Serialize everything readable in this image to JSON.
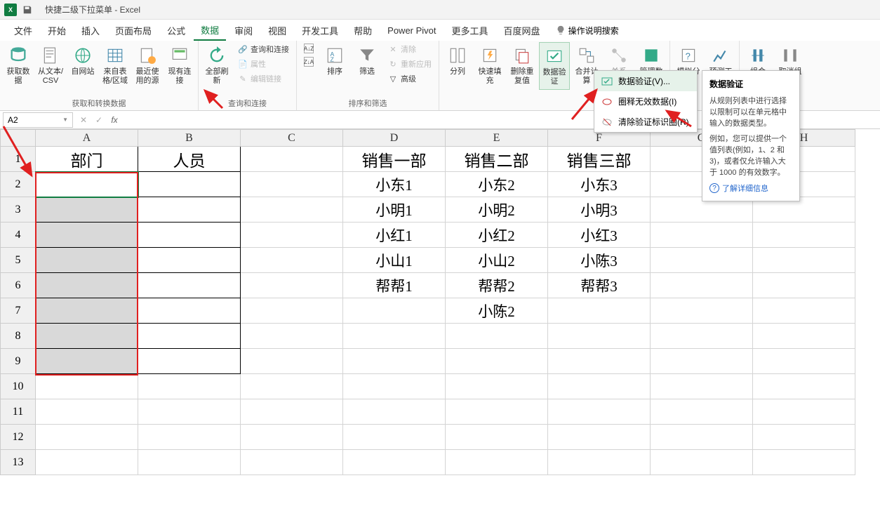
{
  "title": "快捷二级下拉菜单  -  Excel",
  "menu": [
    "文件",
    "开始",
    "插入",
    "页面布局",
    "公式",
    "数据",
    "审阅",
    "视图",
    "开发工具",
    "帮助",
    "Power Pivot",
    "更多工具",
    "百度网盘"
  ],
  "menu_active_index": 5,
  "tell_me": "操作说明搜索",
  "ribbon": {
    "g1": {
      "label": "获取和转换数据",
      "btns": [
        "获取数据",
        "从文本/CSV",
        "自网站",
        "来自表格/区域",
        "最近使用的源",
        "现有连接"
      ]
    },
    "g2": {
      "label": "查询和连接",
      "refresh": "全部刷新",
      "items": [
        "查询和连接",
        "属性",
        "编辑链接"
      ]
    },
    "g3": {
      "label": "排序和筛选",
      "az": "",
      "za": "",
      "sort": "排序",
      "filter": "筛选",
      "clear": "清除",
      "reapply": "重新应用",
      "adv": "高级"
    },
    "g4": {
      "label": "",
      "text_to_col": "分列",
      "flash": "快速填充",
      "dup": "删除重复值",
      "dv": "数据验证",
      "cons": "合并计算",
      "rel": "关系",
      "model": "管理数据模型"
    },
    "g5": {
      "label": "",
      "whatif": "模拟分析",
      "forecast": "预测工作表"
    },
    "g6": {
      "label": "",
      "group": "组合",
      "ungroup": "取消组合"
    }
  },
  "dv_menu": {
    "items": [
      "数据验证(V)...",
      "圈释无效数据(I)",
      "清除验证标识圈(R)"
    ]
  },
  "dv_info": {
    "title": "数据验证",
    "p1": "从规则列表中进行选择以限制可以在单元格中输入的数据类型。",
    "p2": "例如，您可以提供一个值列表(例如，1、2 和 3)，或者仅允许输入大于 1000 的有效数字。",
    "link": "了解详细信息"
  },
  "name_box": "A2",
  "columns": [
    "A",
    "B",
    "C",
    "D",
    "E",
    "F",
    "G",
    "H"
  ],
  "rows": [
    "1",
    "2",
    "3",
    "4",
    "5",
    "6",
    "7",
    "8",
    "9",
    "10",
    "11",
    "12",
    "13"
  ],
  "cells": {
    "A1": "部门",
    "B1": "人员",
    "D1": "销售一部",
    "E1": "销售二部",
    "F1": "销售三部",
    "D2": "小东1",
    "E2": "小东2",
    "F2": "小东3",
    "D3": "小明1",
    "E3": "小明2",
    "F3": "小明3",
    "D4": "小红1",
    "E4": "小红2",
    "F4": "小红3",
    "D5": "小山1",
    "E5": "小山2",
    "F5": "小陈3",
    "D6": "帮帮1",
    "E6": "帮帮2",
    "F6": "帮帮3",
    "E7": "小陈2"
  }
}
